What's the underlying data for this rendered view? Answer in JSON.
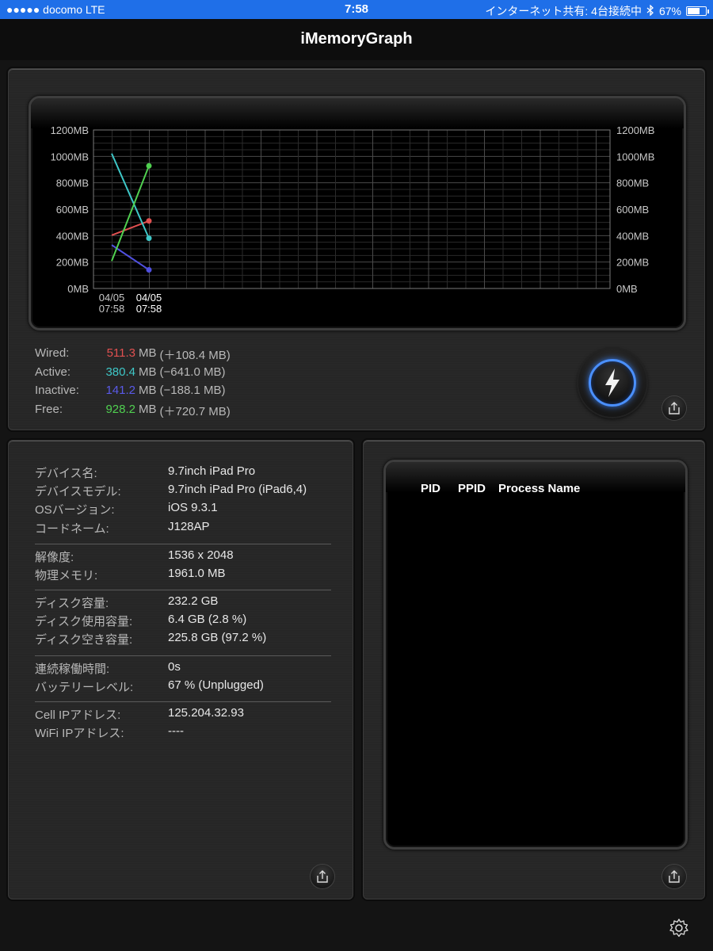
{
  "status_bar": {
    "carrier": "●●●●● docomo  LTE",
    "time": "7:58",
    "tethering": "インターネット共有: 4台接続中",
    "battery_percent": "67%",
    "battery_level": 0.67
  },
  "app": {
    "title": "iMemoryGraph"
  },
  "chart_data": {
    "type": "line",
    "x_labels": [
      {
        "date": "04/05",
        "time": "07:58"
      },
      {
        "date": "04/05",
        "time": "07:58"
      }
    ],
    "y_ticks": [
      "0MB",
      "200MB",
      "400MB",
      "600MB",
      "800MB",
      "1000MB",
      "1200MB"
    ],
    "ylim": [
      0,
      1200
    ],
    "grid": true,
    "series": [
      {
        "name": "Wired",
        "color": "#e05050",
        "values": [
          402.9,
          511.3
        ]
      },
      {
        "name": "Active",
        "color": "#3ec8c8",
        "values": [
          1021.4,
          380.4
        ]
      },
      {
        "name": "Inactive",
        "color": "#5050e0",
        "values": [
          329.3,
          141.2
        ]
      },
      {
        "name": "Free",
        "color": "#50d050",
        "values": [
          207.5,
          928.2
        ]
      }
    ]
  },
  "memory": [
    {
      "label": "Wired:",
      "value": "511.3",
      "unit": "MB",
      "delta": "(＋108.4 MB)",
      "color": "#e05050"
    },
    {
      "label": "Active:",
      "value": "380.4",
      "unit": "MB",
      "delta": "(−641.0 MB)",
      "color": "#3ec8c8"
    },
    {
      "label": "Inactive:",
      "value": "141.2",
      "unit": "MB",
      "delta": "(−188.1 MB)",
      "color": "#5a5ae8"
    },
    {
      "label": "Free:",
      "value": "928.2",
      "unit": "MB",
      "delta": "(＋720.7 MB)",
      "color": "#50d050"
    }
  ],
  "device_info": {
    "group1": [
      {
        "label": "デバイス名:",
        "value": "9.7inch iPad Pro"
      },
      {
        "label": "デバイスモデル:",
        "value": "9.7inch iPad Pro (iPad6,4)"
      },
      {
        "label": "OSバージョン:",
        "value": "iOS 9.3.1"
      },
      {
        "label": "コードネーム:",
        "value": "J128AP"
      }
    ],
    "group2": [
      {
        "label": "解像度:",
        "value": "1536 x 2048"
      },
      {
        "label": "物理メモリ:",
        "value": "1961.0 MB"
      }
    ],
    "group3": [
      {
        "label": "ディスク容量:",
        "value": "232.2 GB"
      },
      {
        "label": "ディスク使用容量:",
        "value": "6.4 GB (2.8 %)"
      },
      {
        "label": "ディスク空き容量:",
        "value": "225.8 GB (97.2 %)"
      }
    ],
    "group4": [
      {
        "label": "連続稼働時間:",
        "value": "0s"
      },
      {
        "label": "バッテリーレベル:",
        "value": "67 % (Unplugged)"
      }
    ],
    "group5": [
      {
        "label": "Cell IPアドレス:",
        "value": "125.204.32.93"
      },
      {
        "label": "WiFi IPアドレス:",
        "value": "----"
      }
    ]
  },
  "process_list": {
    "headers": {
      "pid": "PID",
      "ppid": "PPID",
      "name": "Process Name"
    },
    "rows": []
  },
  "icons": {
    "refresh": "lightning-bolt-icon",
    "share": "share-icon",
    "settings": "gear-icon",
    "bluetooth": "bluetooth-icon"
  }
}
